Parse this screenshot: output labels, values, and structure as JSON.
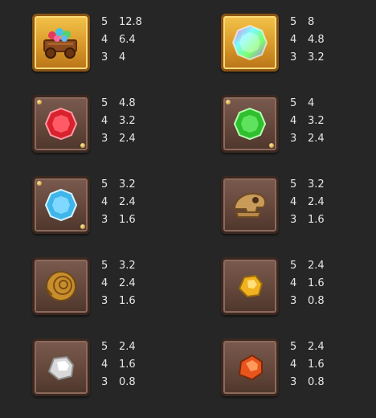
{
  "symbols": [
    {
      "icon": "gem-cart-icon",
      "tile": "gold",
      "pays": [
        {
          "count": "5",
          "value": "12.8"
        },
        {
          "count": "4",
          "value": "6.4"
        },
        {
          "count": "3",
          "value": "4"
        }
      ]
    },
    {
      "icon": "rainbow-gem-icon",
      "tile": "gold",
      "pays": [
        {
          "count": "5",
          "value": "8"
        },
        {
          "count": "4",
          "value": "4.8"
        },
        {
          "count": "3",
          "value": "3.2"
        }
      ]
    },
    {
      "icon": "red-gem-icon",
      "tile": "stone",
      "color": "#d8232f",
      "pays": [
        {
          "count": "5",
          "value": "4.8"
        },
        {
          "count": "4",
          "value": "3.2"
        },
        {
          "count": "3",
          "value": "2.4"
        }
      ]
    },
    {
      "icon": "green-gem-icon",
      "tile": "stone",
      "color": "#2fbf2f",
      "pays": [
        {
          "count": "5",
          "value": "4"
        },
        {
          "count": "4",
          "value": "3.2"
        },
        {
          "count": "3",
          "value": "2.4"
        }
      ]
    },
    {
      "icon": "blue-gem-icon",
      "tile": "stone",
      "color": "#3fb6ea",
      "pays": [
        {
          "count": "5",
          "value": "3.2"
        },
        {
          "count": "4",
          "value": "2.4"
        },
        {
          "count": "3",
          "value": "1.6"
        }
      ]
    },
    {
      "icon": "dino-skull-icon",
      "tile": "stone",
      "pays": [
        {
          "count": "5",
          "value": "3.2"
        },
        {
          "count": "4",
          "value": "2.4"
        },
        {
          "count": "3",
          "value": "1.6"
        }
      ]
    },
    {
      "icon": "ammonite-fossil-icon",
      "tile": "stone",
      "pays": [
        {
          "count": "5",
          "value": "3.2"
        },
        {
          "count": "4",
          "value": "2.4"
        },
        {
          "count": "3",
          "value": "1.6"
        }
      ]
    },
    {
      "icon": "gold-nugget-icon",
      "tile": "stone",
      "pays": [
        {
          "count": "5",
          "value": "2.4"
        },
        {
          "count": "4",
          "value": "1.6"
        },
        {
          "count": "3",
          "value": "0.8"
        }
      ]
    },
    {
      "icon": "white-stone-icon",
      "tile": "stone",
      "pays": [
        {
          "count": "5",
          "value": "2.4"
        },
        {
          "count": "4",
          "value": "1.6"
        },
        {
          "count": "3",
          "value": "0.8"
        }
      ]
    },
    {
      "icon": "orange-stone-icon",
      "tile": "stone",
      "pays": [
        {
          "count": "5",
          "value": "2.4"
        },
        {
          "count": "4",
          "value": "1.6"
        },
        {
          "count": "3",
          "value": "0.8"
        }
      ]
    }
  ]
}
